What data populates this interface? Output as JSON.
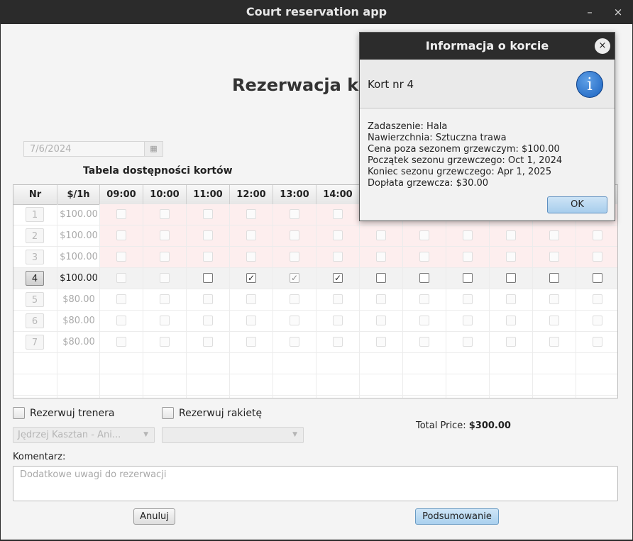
{
  "window": {
    "title": "Court reservation app",
    "minimize": "–",
    "close": "×"
  },
  "heading": "Rezerwacja k",
  "date": {
    "value": "7/6/2024",
    "icon": "calendar-icon"
  },
  "table": {
    "title": "Tabela dostępności kortów",
    "columns": [
      "Nr",
      "$/1h",
      "09:00",
      "10:00",
      "11:00",
      "12:00",
      "13:00",
      "14:00"
    ],
    "rows": [
      {
        "nr": "1",
        "price": "$100.00"
      },
      {
        "nr": "2",
        "price": "$100.00"
      },
      {
        "nr": "3",
        "price": "$100.00"
      },
      {
        "nr": "4",
        "price": "$100.00"
      },
      {
        "nr": "5",
        "price": "$80.00"
      },
      {
        "nr": "6",
        "price": "$80.00"
      },
      {
        "nr": "7",
        "price": "$80.00"
      }
    ],
    "checked_row_4": [
      "12:00",
      "13:00",
      "14:00"
    ]
  },
  "options": {
    "trainer_label": "Rezerwuj trenera",
    "racket_label": "Rezerwuj rakietę",
    "trainer_value": "Jędrzej Kasztan - Ani...",
    "racket_value": ""
  },
  "total": {
    "label": "Total Price:",
    "value": "$300.00"
  },
  "comment": {
    "label": "Komentarz:",
    "placeholder": "Dodatkowe uwagi do rezerwacji"
  },
  "buttons": {
    "cancel": "Anuluj",
    "summary": "Podsumowanie"
  },
  "dialog": {
    "title": "Informacja o korcie",
    "close": "×",
    "header": "Kort nr 4",
    "icon": "i",
    "lines": [
      "Zadaszenie: Hala",
      "Nawierzchnia: Sztuczna trawa",
      "Cena poza sezonem grzewczym: $100.00",
      "Początek sezonu grzewczego: Oct 1, 2024",
      "Koniec sezonu grzewczego: Apr 1, 2025",
      "Dopłata grzewcza: $30.00"
    ],
    "ok": "OK"
  },
  "colors": {
    "title_bar": "#2b2b2b",
    "unavailable_row": "#fdeeee",
    "accent_button": "#a9d0ee"
  }
}
